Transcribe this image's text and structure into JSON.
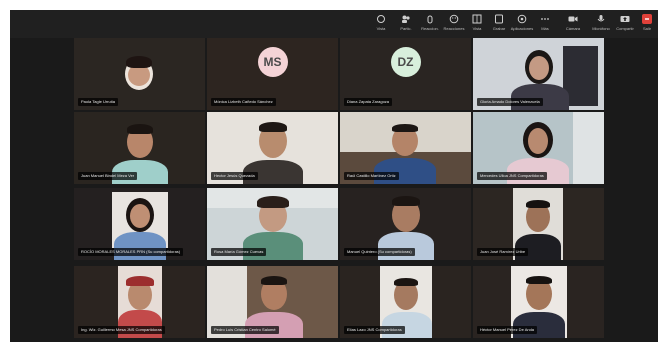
{
  "toolbar": {
    "buttons": [
      {
        "name": "view-button",
        "label": "Vista"
      },
      {
        "name": "participants-button",
        "label": "Partic."
      },
      {
        "name": "reactions-button",
        "label": "Reaccion."
      },
      {
        "name": "chat-button",
        "label": "Reacciones"
      },
      {
        "name": "share-button",
        "label": "Vista"
      },
      {
        "name": "record-button",
        "label": "Grabar"
      },
      {
        "name": "apps-button",
        "label": "Aplicaciones"
      },
      {
        "name": "more-button",
        "label": "Más"
      },
      {
        "name": "camera-button",
        "label": "Cámara"
      },
      {
        "name": "microphone-button",
        "label": "Micrófono"
      },
      {
        "name": "share-screen-button",
        "label": "Compartir"
      },
      {
        "name": "leave-button",
        "label": "Salir"
      }
    ]
  },
  "participants": [
    {
      "name": "Paola Tagle Urrutia",
      "avatar": ""
    },
    {
      "name": "Mónica Lizbeth Cañedo Sánchez",
      "avatar": "MS"
    },
    {
      "name": "Diana Zapata Zaragoza",
      "avatar": "DZ"
    },
    {
      "name": "Gloria Amado Dolores Valenzuela",
      "avatar": ""
    },
    {
      "name": "Juan Manuel Bindel Meza Ver",
      "avatar": ""
    },
    {
      "name": "Hector Jesús Quezada",
      "avatar": ""
    },
    {
      "name": "Raúl Castillo Martínez Ortiz",
      "avatar": ""
    },
    {
      "name": "Mercedes Ulloa JNS Compartidoras",
      "avatar": ""
    },
    {
      "name": "ROCÍO MORALES MORALES PRN (Su compartidoras)",
      "avatar": ""
    },
    {
      "name": "Rosa María Gómez Cuevas",
      "avatar": ""
    },
    {
      "name": "Manuel Quintero (Su compartidoras)",
      "avatar": ""
    },
    {
      "name": "Juan José Ramírez Uribe",
      "avatar": ""
    },
    {
      "name": "Ing. Wiz. Guillermo Mesa JNS Compartidoras",
      "avatar": ""
    },
    {
      "name": "Pedro Luis Cristian Centro Salomé",
      "avatar": ""
    },
    {
      "name": "Elías Lazo JNS Compartidoras",
      "avatar": ""
    },
    {
      "name": "Héctor Manuel Pérez De Anda",
      "avatar": ""
    }
  ]
}
